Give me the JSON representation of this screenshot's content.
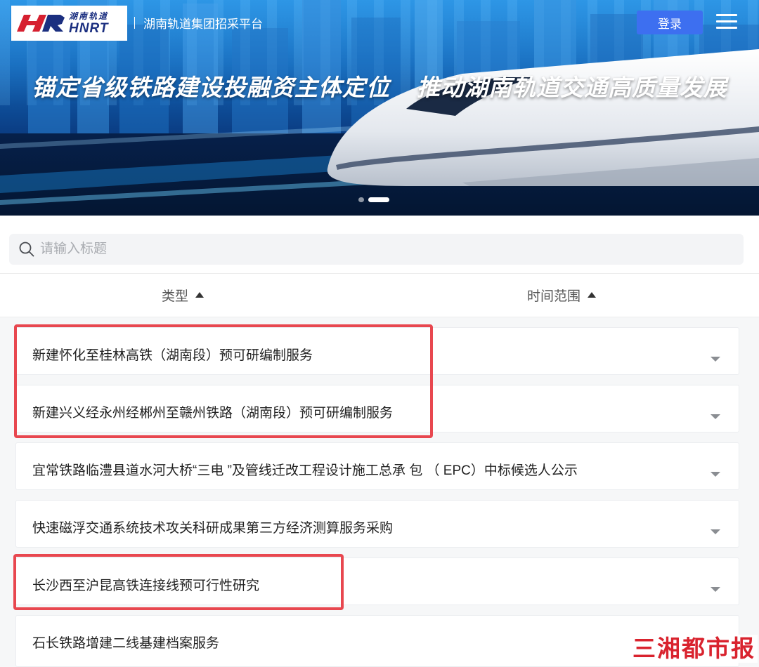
{
  "header": {
    "logo_cn": "湖南轨道",
    "logo_en": "HNRT",
    "platform_title": "湖南轨道集团招采平台",
    "login_label": "登录",
    "menu_icon": "hamburger-icon"
  },
  "banner": {
    "slogan_left": "锚定省级铁路建设投融资主体定位",
    "slogan_right": "推动湖南轨道交通高质量发展",
    "slide_count": 2,
    "active_slide": 2
  },
  "search": {
    "placeholder": "请输入标题",
    "value": "",
    "icon": "search-icon"
  },
  "filters": [
    {
      "label": "类型"
    },
    {
      "label": "时间范围"
    }
  ],
  "list": {
    "items": [
      {
        "title": "新建怀化至桂林高铁（湖南段）预可研编制服务",
        "highlighted": true
      },
      {
        "title": "新建兴义经永州经郴州至赣州铁路（湖南段）预可研编制服务",
        "highlighted": true
      },
      {
        "title": "宜常铁路临澧县道水河大桥“三电 ”及管线迁改工程设计施工总承 包 （ EPC）中标候选人公示",
        "highlighted": false
      },
      {
        "title": "快速磁浮交通系统技术攻关科研成果第三方经济测算服务采购",
        "highlighted": false
      },
      {
        "title": "长沙西至沪昆高铁连接线预可行性研究",
        "highlighted": true
      },
      {
        "title": "石长铁路增建二线基建档案服务",
        "highlighted": false
      }
    ]
  },
  "watermark": "三湘都市报",
  "colors": {
    "accent": "#3d6ff0",
    "highlight": "#e8474f",
    "brand_navy": "#1b2f80",
    "watermark": "#d9232e"
  }
}
